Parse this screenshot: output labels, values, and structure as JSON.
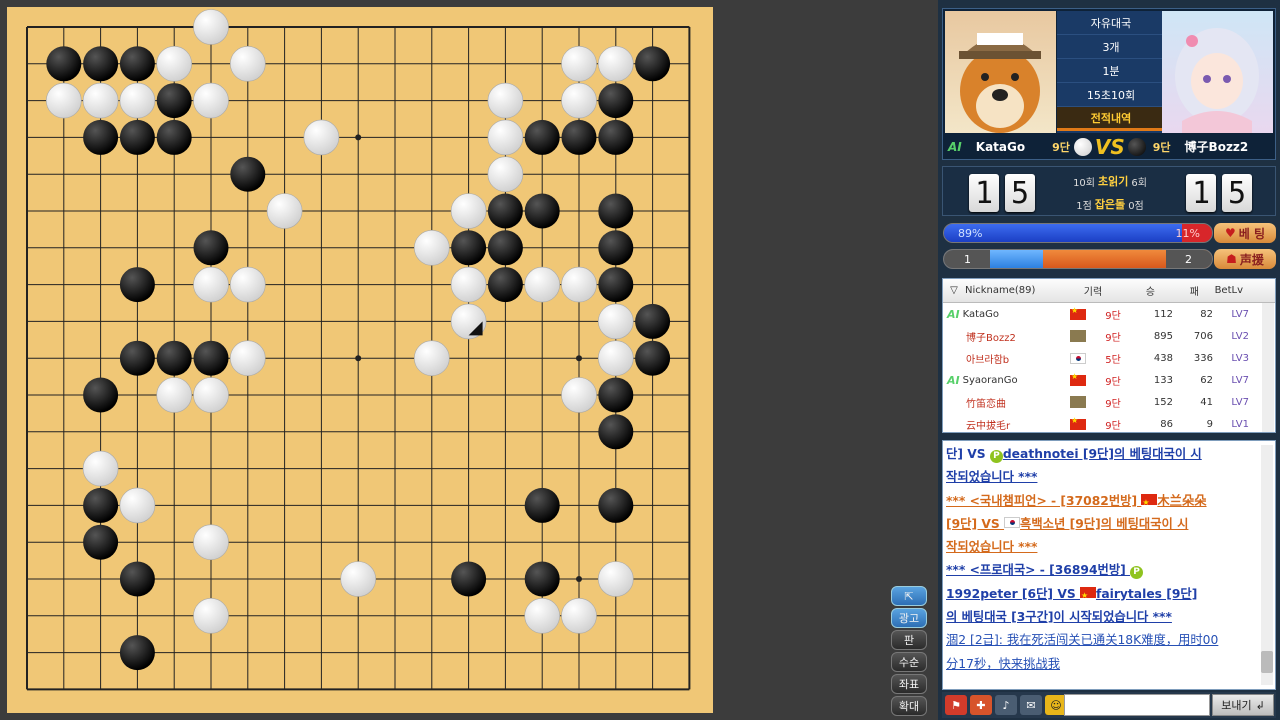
{
  "board": {
    "size": 19,
    "black_stones": [
      [
        1,
        1
      ],
      [
        2,
        1
      ],
      [
        3,
        1
      ],
      [
        17,
        1
      ],
      [
        4,
        2
      ],
      [
        16,
        2
      ],
      [
        2,
        3
      ],
      [
        3,
        3
      ],
      [
        4,
        3
      ],
      [
        14,
        3
      ],
      [
        15,
        3
      ],
      [
        16,
        3
      ],
      [
        6,
        4
      ],
      [
        13,
        5
      ],
      [
        14,
        5
      ],
      [
        16,
        5
      ],
      [
        5,
        6
      ],
      [
        12,
        6
      ],
      [
        13,
        6
      ],
      [
        16,
        6
      ],
      [
        3,
        7
      ],
      [
        13,
        7
      ],
      [
        16,
        7
      ],
      [
        17,
        8
      ],
      [
        3,
        9
      ],
      [
        4,
        9
      ],
      [
        5,
        9
      ],
      [
        17,
        9
      ],
      [
        2,
        10
      ],
      [
        16,
        10
      ],
      [
        16,
        11
      ],
      [
        2,
        13
      ],
      [
        14,
        13
      ],
      [
        16,
        13
      ],
      [
        2,
        14
      ],
      [
        3,
        15
      ],
      [
        12,
        15
      ],
      [
        14,
        15
      ],
      [
        3,
        17
      ]
    ],
    "white_stones": [
      [
        5,
        0
      ],
      [
        4,
        1
      ],
      [
        6,
        1
      ],
      [
        15,
        1
      ],
      [
        16,
        1
      ],
      [
        1,
        2
      ],
      [
        2,
        2
      ],
      [
        3,
        2
      ],
      [
        5,
        2
      ],
      [
        13,
        2
      ],
      [
        15,
        2
      ],
      [
        8,
        3
      ],
      [
        13,
        3
      ],
      [
        13,
        4
      ],
      [
        7,
        5
      ],
      [
        12,
        5
      ],
      [
        11,
        6
      ],
      [
        5,
        7
      ],
      [
        6,
        7
      ],
      [
        12,
        7
      ],
      [
        14,
        7
      ],
      [
        15,
        7
      ],
      [
        16,
        8
      ],
      [
        12,
        8
      ],
      [
        6,
        9
      ],
      [
        11,
        9
      ],
      [
        16,
        9
      ],
      [
        4,
        10
      ],
      [
        5,
        10
      ],
      [
        15,
        10
      ],
      [
        2,
        12
      ],
      [
        3,
        13
      ],
      [
        5,
        14
      ],
      [
        9,
        15
      ],
      [
        16,
        15
      ],
      [
        5,
        16
      ],
      [
        14,
        16
      ],
      [
        15,
        16
      ]
    ],
    "last_move": [
      12,
      8
    ]
  },
  "side_buttons": [
    "광고",
    "판",
    "수순",
    "좌표",
    "확대"
  ],
  "match": {
    "mode": "자유대국",
    "periods": "3개",
    "main_time": "1분",
    "byoyomi": "15초10회",
    "record_label": "전적내역",
    "white_player": {
      "ai": "AI",
      "name": "KataGo",
      "rank": "9단"
    },
    "black_player": {
      "name": "博子Bozz2",
      "rank": "9단"
    },
    "vs": "VS"
  },
  "score": {
    "left_digits": [
      "1",
      "5"
    ],
    "right_digits": [
      "1",
      "5"
    ],
    "readings_left": "10회",
    "readings_label": "초읽기",
    "readings_right": "6회",
    "captures_left": "1점",
    "captures_label": "잡은돌",
    "captures_right": "0점"
  },
  "win_prob": {
    "white": "89%",
    "black": "11%",
    "white_fraction": 0.89,
    "button": "베 팅"
  },
  "support": {
    "left": "1",
    "right": "2",
    "left_fraction": 0.2,
    "button": "声援"
  },
  "player_list": {
    "headers": {
      "nickname": "Nickname(89)",
      "rank": "기력",
      "wins": "승",
      "losses": "패",
      "level": "BetLv"
    },
    "rows": [
      {
        "ai": "AI",
        "name": "KataGo",
        "flag": "cn",
        "rank": "9단",
        "wins": "112",
        "losses": "82",
        "level": "LV7"
      },
      {
        "ai": "",
        "name": "博子Bozz2",
        "flag": "pic",
        "rank": "9단",
        "wins": "895",
        "losses": "706",
        "level": "LV2"
      },
      {
        "ai": "",
        "name": "아브라함b",
        "flag": "kr",
        "rank": "5단",
        "wins": "438",
        "losses": "336",
        "level": "LV3"
      },
      {
        "ai": "AI",
        "name": "SyaoranGo",
        "flag": "cn",
        "rank": "9단",
        "wins": "133",
        "losses": "62",
        "level": "LV7"
      },
      {
        "ai": "",
        "name": "竹笛恋曲",
        "flag": "pic",
        "rank": "9단",
        "wins": "152",
        "losses": "41",
        "level": "LV7"
      },
      {
        "ai": "",
        "name": "云中拔毛r",
        "flag": "cn",
        "rank": "9단",
        "wins": "86",
        "losses": "9",
        "level": "LV1"
      }
    ]
  },
  "chat": {
    "l1a": "단] VS ",
    "l1b": "deathnotei [9단]의 베팅대국이 시",
    "l2": "작되었습니다 ***",
    "l3a": "*** <국내챔피언> - [37082번방] ",
    "l3b": "木兰朵朵",
    "l4a": "[9단] VS ",
    "l4b": "흑백소년 [9단]의 베팅대국이 시",
    "l5": "작되었습니다 ***",
    "l6": "*** <프로대국> - [36894번방] ",
    "l7a": "1992peter [6단] VS ",
    "l7b": "fairytales [9단]",
    "l8": "의 베팅대국 [3구간]이 시작되었습니다 ***",
    "l9": "涸2 [2급]: 我在死活闯关已通关18K难度，用时00",
    "l10": "分17秒，快来挑战我"
  },
  "chat_bar": {
    "send": "보내기"
  }
}
